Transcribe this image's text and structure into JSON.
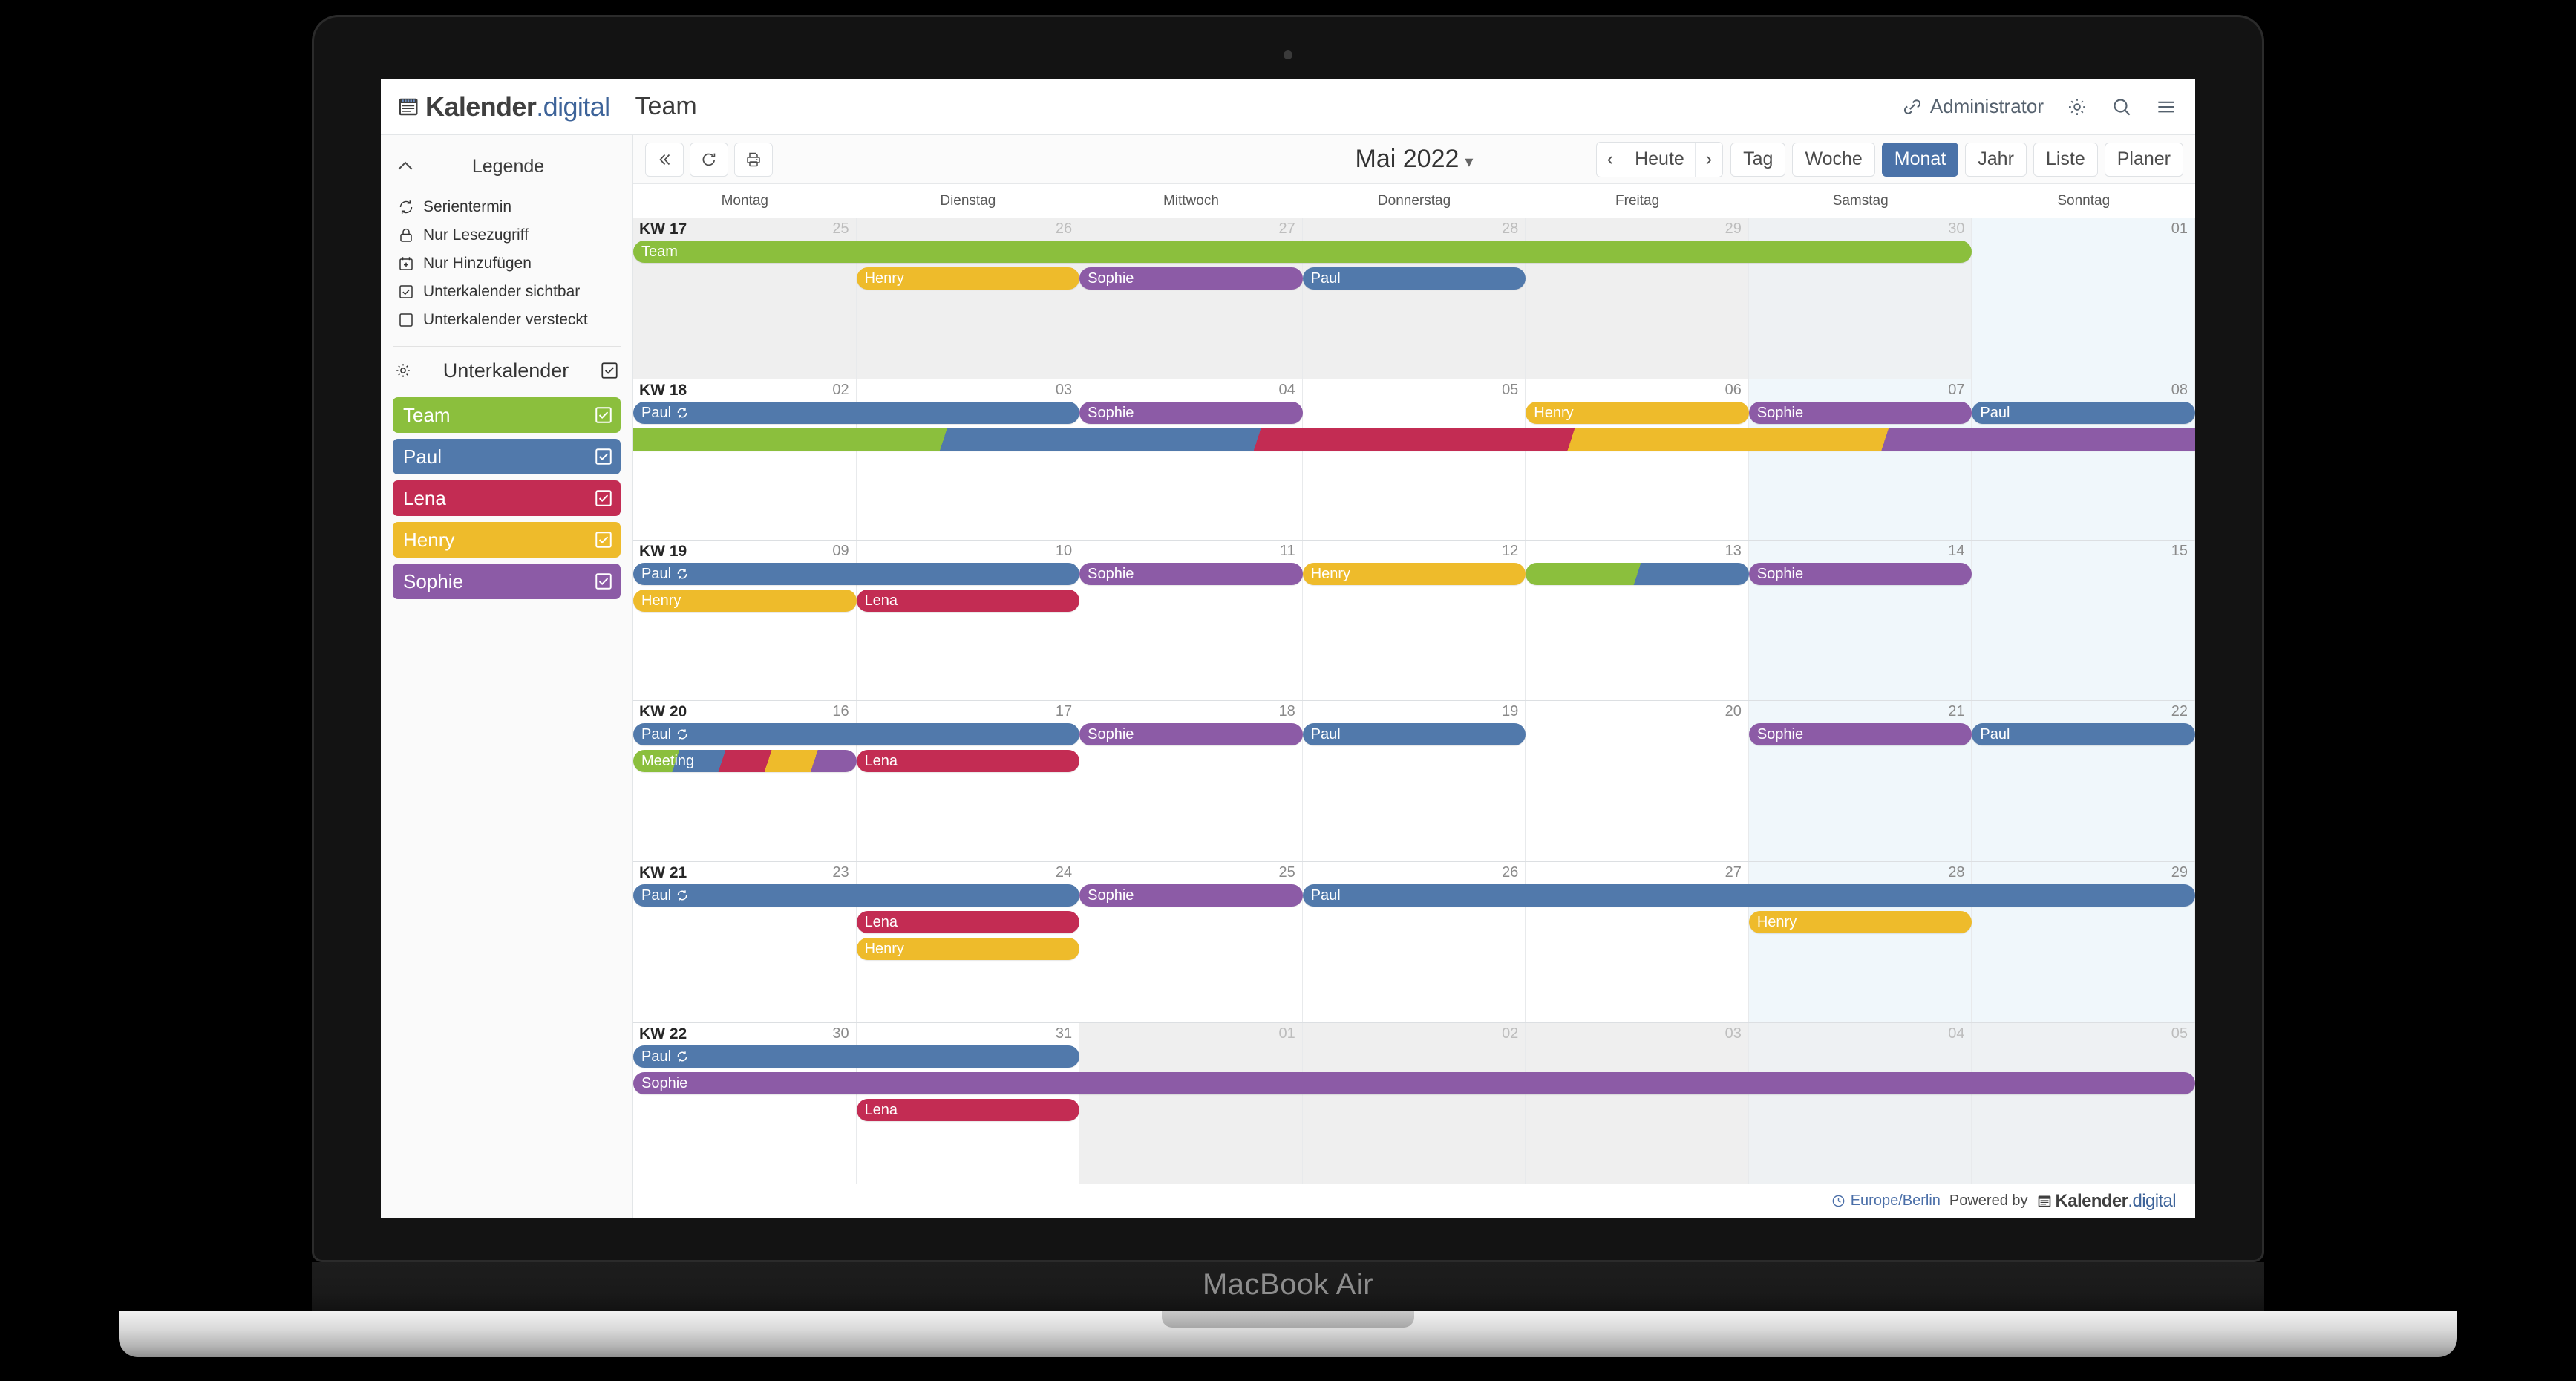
{
  "device": {
    "label": "MacBook Air"
  },
  "header": {
    "logo": {
      "icon": "calendar-logo-icon",
      "primary": "Kalender",
      "secondary": ".digital"
    },
    "title": "Team",
    "user": {
      "icon": "link-icon",
      "label": "Administrator"
    },
    "icons": [
      "gear-icon",
      "search-icon",
      "menu-icon"
    ]
  },
  "sidebar": {
    "legend": {
      "collapse_icon": "chevron-up-icon",
      "title": "Legende",
      "items": [
        {
          "icon": "recurring-icon",
          "label": "Serientermin"
        },
        {
          "icon": "lock-icon",
          "label": "Nur Lesezugriff"
        },
        {
          "icon": "calendar-plus-icon",
          "label": "Nur Hinzufügen"
        },
        {
          "icon": "checkbox-checked-icon",
          "label": "Unterkalender sichtbar"
        },
        {
          "icon": "checkbox-empty-icon",
          "label": "Unterkalender versteckt"
        }
      ]
    },
    "subcalendars": {
      "gear_icon": "gear-icon",
      "title": "Unterkalender",
      "all_checked": true,
      "items": [
        {
          "name": "Team",
          "color": "#8bbf3d",
          "checked": true
        },
        {
          "name": "Paul",
          "color": "#5179ab",
          "checked": true
        },
        {
          "name": "Lena",
          "color": "#c32c53",
          "checked": true
        },
        {
          "name": "Henry",
          "color": "#eebb2b",
          "checked": true
        },
        {
          "name": "Sophie",
          "color": "#8c5ba6",
          "checked": true
        }
      ]
    }
  },
  "toolbar": {
    "buttons": [
      {
        "icon": "collapse-sidebar-icon",
        "name": "collapse-sidebar-button"
      },
      {
        "icon": "refresh-icon",
        "name": "refresh-button"
      },
      {
        "icon": "print-icon",
        "name": "print-button"
      }
    ],
    "date_title": "Mai 2022",
    "date_caret": "▾",
    "nav": {
      "prev": "‹",
      "today": "Heute",
      "next": "›"
    },
    "views": [
      {
        "label": "Tag",
        "active": false
      },
      {
        "label": "Woche",
        "active": false
      },
      {
        "label": "Monat",
        "active": true
      },
      {
        "label": "Jahr",
        "active": false
      },
      {
        "label": "Liste",
        "active": false
      },
      {
        "label": "Planer",
        "active": false
      }
    ]
  },
  "calendar": {
    "weekdays": [
      "Montag",
      "Dienstag",
      "Mittwoch",
      "Donnerstag",
      "Freitag",
      "Samstag",
      "Sonntag"
    ],
    "weeks": [
      {
        "kw": "KW 17",
        "days": [
          {
            "num": "25",
            "other": true
          },
          {
            "num": "26",
            "other": true
          },
          {
            "num": "27",
            "other": true
          },
          {
            "num": "28",
            "other": true
          },
          {
            "num": "29",
            "other": true
          },
          {
            "num": "30",
            "other": true,
            "weekend": true
          },
          {
            "num": "01",
            "other": false,
            "weekend": true
          }
        ],
        "events": [
          {
            "label": "Team",
            "color": "#8bbf3d",
            "start": 0,
            "span": 6,
            "row": 0,
            "recurring": false
          },
          {
            "label": "Henry",
            "color": "#eebb2b",
            "start": 1,
            "span": 1,
            "row": 1,
            "recurring": false
          },
          {
            "label": "Sophie",
            "color": "#8c5ba6",
            "start": 2,
            "span": 1,
            "row": 1,
            "recurring": false
          },
          {
            "label": "Paul",
            "color": "#5179ab",
            "start": 3,
            "span": 1,
            "row": 1,
            "recurring": false
          }
        ]
      },
      {
        "kw": "KW 18",
        "days": [
          {
            "num": "02",
            "other": false
          },
          {
            "num": "03",
            "other": false
          },
          {
            "num": "04",
            "other": false
          },
          {
            "num": "05",
            "other": false
          },
          {
            "num": "06",
            "other": false
          },
          {
            "num": "07",
            "other": false,
            "weekend": true
          },
          {
            "num": "08",
            "other": false,
            "weekend": true
          }
        ],
        "events": [
          {
            "label": "Paul",
            "color": "#5179ab",
            "start": 0,
            "span": 2,
            "row": 0,
            "recurring": true
          },
          {
            "label": "Sophie",
            "color": "#8c5ba6",
            "start": 2,
            "span": 1,
            "row": 0,
            "recurring": false
          },
          {
            "label": "Henry",
            "color": "#eebb2b",
            "start": 4,
            "span": 1,
            "row": 0,
            "recurring": false
          },
          {
            "label": "Sophie",
            "color": "#8c5ba6",
            "start": 5,
            "span": 1,
            "row": 0,
            "recurring": false
          },
          {
            "label": "Paul",
            "color": "#5179ab",
            "start": 6,
            "span": 1,
            "row": 0,
            "recurring": false
          },
          {
            "label": "",
            "multicolor": [
              "#8bbf3d",
              "#5179ab",
              "#c32c53",
              "#eebb2b",
              "#8c5ba6"
            ],
            "start": 0,
            "span": 7,
            "row": 1,
            "flat": true,
            "recurring": false
          }
        ]
      },
      {
        "kw": "KW 19",
        "days": [
          {
            "num": "09",
            "other": false
          },
          {
            "num": "10",
            "other": false
          },
          {
            "num": "11",
            "other": false
          },
          {
            "num": "12",
            "other": false
          },
          {
            "num": "13",
            "other": false
          },
          {
            "num": "14",
            "other": false,
            "weekend": true
          },
          {
            "num": "15",
            "other": false,
            "weekend": true
          }
        ],
        "events": [
          {
            "label": "Paul",
            "color": "#5179ab",
            "start": 0,
            "span": 2,
            "row": 0,
            "recurring": true
          },
          {
            "label": "Sophie",
            "color": "#8c5ba6",
            "start": 2,
            "span": 1,
            "row": 0,
            "recurring": false
          },
          {
            "label": "Henry",
            "color": "#eebb2b",
            "start": 3,
            "span": 1,
            "row": 0,
            "recurring": false
          },
          {
            "label": "",
            "multicolor": [
              "#8bbf3d",
              "#5179ab"
            ],
            "start": 4,
            "span": 1,
            "row": 0,
            "recurring": false
          },
          {
            "label": "Sophie",
            "color": "#8c5ba6",
            "start": 5,
            "span": 1,
            "row": 0,
            "recurring": false
          },
          {
            "label": "Henry",
            "color": "#eebb2b",
            "start": 0,
            "span": 1,
            "row": 1,
            "recurring": false
          },
          {
            "label": "Lena",
            "color": "#c32c53",
            "start": 1,
            "span": 1,
            "row": 1,
            "recurring": false
          }
        ]
      },
      {
        "kw": "KW 20",
        "days": [
          {
            "num": "16",
            "other": false
          },
          {
            "num": "17",
            "other": false
          },
          {
            "num": "18",
            "other": false
          },
          {
            "num": "19",
            "other": false
          },
          {
            "num": "20",
            "other": false
          },
          {
            "num": "21",
            "other": false,
            "weekend": true
          },
          {
            "num": "22",
            "other": false,
            "weekend": true
          }
        ],
        "events": [
          {
            "label": "Paul",
            "color": "#5179ab",
            "start": 0,
            "span": 2,
            "row": 0,
            "recurring": true
          },
          {
            "label": "Sophie",
            "color": "#8c5ba6",
            "start": 2,
            "span": 1,
            "row": 0,
            "recurring": false
          },
          {
            "label": "Paul",
            "color": "#5179ab",
            "start": 3,
            "span": 1,
            "row": 0,
            "recurring": false
          },
          {
            "label": "Sophie",
            "color": "#8c5ba6",
            "start": 5,
            "span": 1,
            "row": 0,
            "recurring": false
          },
          {
            "label": "Paul",
            "color": "#5179ab",
            "start": 6,
            "span": 1,
            "row": 0,
            "recurring": false
          },
          {
            "label": "Meeting",
            "multicolor": [
              "#8bbf3d",
              "#5179ab",
              "#c32c53",
              "#eebb2b",
              "#8c5ba6"
            ],
            "start": 0,
            "span": 1,
            "row": 1,
            "recurring": false
          },
          {
            "label": "Lena",
            "color": "#c32c53",
            "start": 1,
            "span": 1,
            "row": 1,
            "recurring": false
          }
        ]
      },
      {
        "kw": "KW 21",
        "days": [
          {
            "num": "23",
            "other": false
          },
          {
            "num": "24",
            "other": false
          },
          {
            "num": "25",
            "other": false
          },
          {
            "num": "26",
            "other": false
          },
          {
            "num": "27",
            "other": false
          },
          {
            "num": "28",
            "other": false,
            "weekend": true
          },
          {
            "num": "29",
            "other": false,
            "weekend": true
          }
        ],
        "events": [
          {
            "label": "Paul",
            "color": "#5179ab",
            "start": 0,
            "span": 2,
            "row": 0,
            "recurring": true
          },
          {
            "label": "Sophie",
            "color": "#8c5ba6",
            "start": 2,
            "span": 1,
            "row": 0,
            "recurring": false
          },
          {
            "label": "Paul",
            "color": "#5179ab",
            "start": 3,
            "span": 4,
            "row": 0,
            "recurring": false
          },
          {
            "label": "Lena",
            "color": "#c32c53",
            "start": 1,
            "span": 1,
            "row": 1,
            "recurring": false
          },
          {
            "label": "Henry",
            "color": "#eebb2b",
            "start": 5,
            "span": 1,
            "row": 1,
            "recurring": false
          },
          {
            "label": "Henry",
            "color": "#eebb2b",
            "start": 1,
            "span": 1,
            "row": 2,
            "recurring": false
          }
        ]
      },
      {
        "kw": "KW 22",
        "days": [
          {
            "num": "30",
            "other": false
          },
          {
            "num": "31",
            "other": false
          },
          {
            "num": "01",
            "other": true
          },
          {
            "num": "02",
            "other": true
          },
          {
            "num": "03",
            "other": true
          },
          {
            "num": "04",
            "other": true,
            "weekend": true
          },
          {
            "num": "05",
            "other": true,
            "weekend": true
          }
        ],
        "events": [
          {
            "label": "Paul",
            "color": "#5179ab",
            "start": 0,
            "span": 2,
            "row": 0,
            "recurring": true
          },
          {
            "label": "Sophie",
            "color": "#8c5ba6",
            "start": 0,
            "span": 7,
            "row": 1,
            "recurring": false
          },
          {
            "label": "Lena",
            "color": "#c32c53",
            "start": 1,
            "span": 1,
            "row": 2,
            "recurring": false
          }
        ]
      }
    ]
  },
  "footer": {
    "clock_icon": "clock-icon",
    "timezone": "Europe/Berlin",
    "powered_by": "Powered by",
    "logo": {
      "primary": "Kalender",
      "secondary": ".digital"
    }
  }
}
